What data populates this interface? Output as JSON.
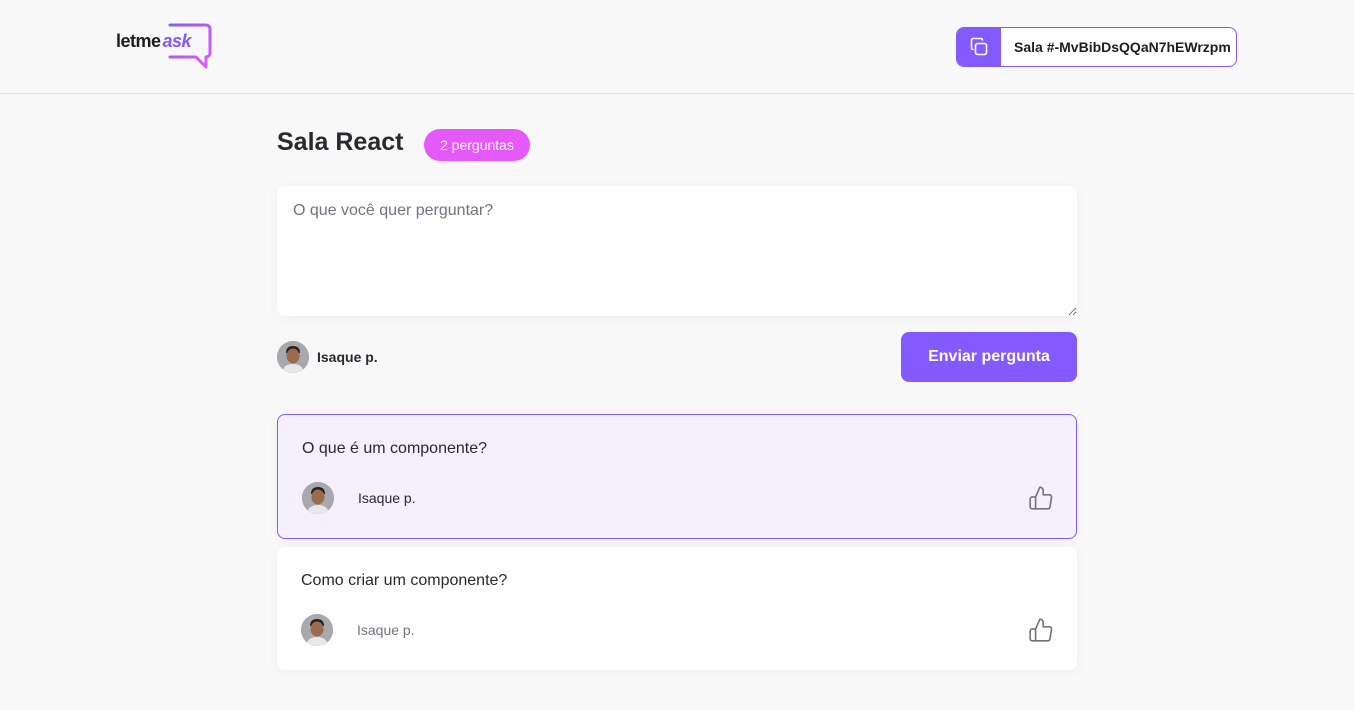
{
  "header": {
    "logo_main": "letme",
    "logo_accent": "ask",
    "room_code_label": "Sala #-MvBibDsQQaN7hEWrzpm"
  },
  "room": {
    "title": "Sala React",
    "question_count": "2 perguntas"
  },
  "form": {
    "placeholder": "O que você quer perguntar?",
    "value": "",
    "user_name": "Isaque p.",
    "send_label": "Enviar pergunta"
  },
  "questions": [
    {
      "content": "O que é um componente?",
      "author": "Isaque p.",
      "highlighted": true
    },
    {
      "content": "Como criar um componente?",
      "author": "Isaque p.",
      "highlighted": false
    }
  ],
  "colors": {
    "brand": "#835afd",
    "badge": "#e559f9",
    "background": "#f8f8f8",
    "highlight_bg": "#f4f0ff"
  },
  "icons": {
    "copy": "copy-icon",
    "like": "thumbs-up-icon",
    "logo": "speech-bubble-logo"
  }
}
